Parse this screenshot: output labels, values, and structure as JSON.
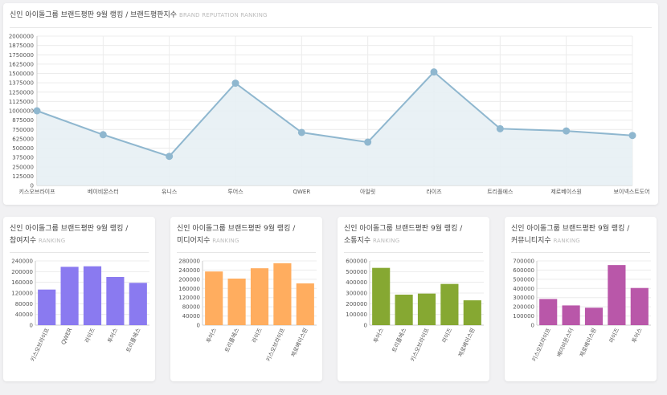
{
  "colors": {
    "line": "#8fb7cf",
    "area": "#e7eff4",
    "participation": "#8a7af0",
    "media": "#ffad5f",
    "communication": "#86a832",
    "community": "#b957a9",
    "grid": "#ececec",
    "axis": "#999999",
    "label": "#555555"
  },
  "charts": [
    {
      "id": "brand",
      "title": "신인 아이돌그룹 브랜드평판 9월 랭킹 / 브랜드평판지수",
      "subtitle": "BRAND REPUTATION RANKING",
      "chart_data": {
        "type": "line",
        "categories": [
          "키스오브라이프",
          "베이비몬스터",
          "유니스",
          "투어스",
          "QWER",
          "아일릿",
          "라이즈",
          "트리플에스",
          "제로베이스원",
          "보이넥스트도어"
        ],
        "values": [
          1000000,
          680000,
          390000,
          1370000,
          710000,
          580000,
          1520000,
          760000,
          730000,
          670000
        ],
        "ylim": [
          0,
          2000000
        ],
        "yticks": [
          0,
          125000,
          250000,
          375000,
          500000,
          625000,
          750000,
          875000,
          1000000,
          1125000,
          1250000,
          1375000,
          1500000,
          1625000,
          1750000,
          1875000,
          2000000
        ],
        "grid": true
      }
    },
    {
      "id": "participation",
      "title_line1": "신인 아이돌그룹 브랜드평판 9월 랭킹 /",
      "title_line2": "참여지수",
      "subtitle": "RANKING",
      "chart_data": {
        "type": "bar",
        "categories": [
          "키스오브라이프",
          "QWER",
          "라이즈",
          "투어스",
          "트리플에스"
        ],
        "values": [
          133000,
          218000,
          220000,
          180000,
          158000
        ],
        "ylim": [
          0,
          240000
        ],
        "yticks": [
          0,
          40000,
          80000,
          120000,
          160000,
          200000,
          240000
        ]
      }
    },
    {
      "id": "media",
      "title_line1": "신인 아이돌그룹 브랜드평판 9월 랭킹 /",
      "title_line2": "미디어지수",
      "subtitle": "RANKING",
      "chart_data": {
        "type": "bar",
        "categories": [
          "투어스",
          "트리플에스",
          "라이즈",
          "키스오브라이프",
          "제로베이스원"
        ],
        "values": [
          234000,
          203000,
          248000,
          270000,
          182000
        ],
        "ylim": [
          0,
          280000
        ],
        "yticks": [
          0,
          40000,
          80000,
          120000,
          160000,
          200000,
          240000,
          280000
        ]
      }
    },
    {
      "id": "communication",
      "title_line1": "신인 아이돌그룹 브랜드평판 9월 랭킹 /",
      "title_line2": "소통지수",
      "subtitle": "RANKING",
      "chart_data": {
        "type": "bar",
        "categories": [
          "투어스",
          "트리플에스",
          "키스오브라이프",
          "라이즈",
          "제로베이스원"
        ],
        "values": [
          535000,
          285000,
          295000,
          385000,
          232000
        ],
        "ylim": [
          0,
          600000
        ],
        "yticks": [
          0,
          100000,
          200000,
          300000,
          400000,
          500000,
          600000
        ]
      }
    },
    {
      "id": "community",
      "title_line1": "신인 아이돌그룹 브랜드평판 9월 랭킹 /",
      "title_line2": "커뮤니티지수",
      "subtitle": "RANKING",
      "chart_data": {
        "type": "bar",
        "categories": [
          "키스오브라이프",
          "베이비몬스터",
          "제로베이스원",
          "라이즈",
          "투어스"
        ],
        "values": [
          285000,
          215000,
          190000,
          655000,
          405000
        ],
        "ylim": [
          0,
          700000
        ],
        "yticks": [
          0,
          100000,
          200000,
          300000,
          400000,
          500000,
          600000,
          700000
        ]
      }
    }
  ]
}
